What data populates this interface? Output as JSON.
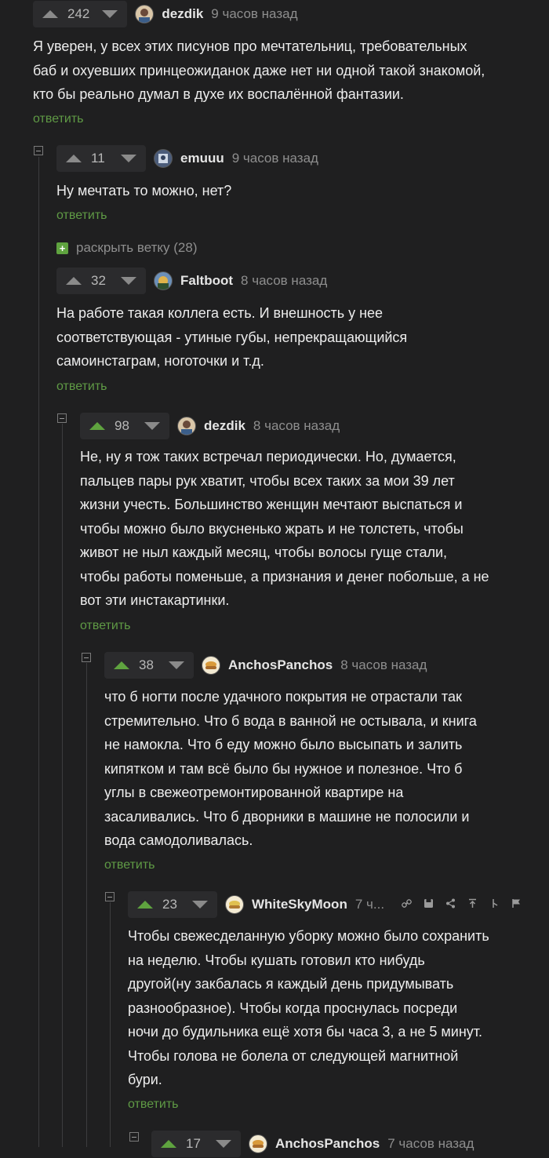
{
  "reply_label": "ответить",
  "colors": {
    "accent_green": "#5fa33f",
    "background": "#1f1f20"
  },
  "comments": [
    {
      "rating": "242",
      "user": "dezdik",
      "time": "9 часов назад",
      "lines": [
        "Я уверен, у всех этих писунов про мечтательниц, требовательных",
        "баб и охуевших принцеожиданок даже нет ни одной такой знакомой,",
        "кто бы реально думал в духе их воспалённой фантазии."
      ]
    },
    {
      "rating": "11",
      "user": "emuuu",
      "time": "9 часов назад",
      "lines": [
        "Ну мечтать то можно, нет?"
      ]
    },
    {
      "rating": "32",
      "user": "Faltboot",
      "time": "8 часов назад",
      "lines": [
        "На работе такая коллега есть. И внешность у нее",
        "соответствующая - утиные губы, непрекращающийся",
        "самоинстаграм, ноготочки и т.д."
      ]
    },
    {
      "rating": "98",
      "user": "dezdik",
      "time": "8 часов назад",
      "lines": [
        "Не, ну я тож таких встречал периодически. Но, думается,",
        "пальцев пары рук хватит, чтобы всех таких за мои 39 лет",
        "жизни учесть. Большинство женщин мечтают выспаться и",
        "чтобы можно было вкусненько жрать и не толстеть, чтобы",
        "живот не ныл каждый месяц, чтобы волосы гуще стали,",
        "чтобы работы поменьше, а признания и денег побольше, а не",
        "вот эти инстакартинки."
      ]
    },
    {
      "rating": "38",
      "user": "AnchosPanchos",
      "time": "8 часов назад",
      "lines": [
        "что б ногти после удачного покрытия не отрастали так",
        "стремительно. Что б вода в ванной не остывала, и книга",
        "не намокла. Что б еду можно было высыпать и залить",
        "кипятком и там всё было бы нужное и полезное. Что б",
        "углы в свежеотремонтированной квартире на",
        "засаливались. Что б дворники в машине не полосили и",
        "вода самодоливалась."
      ]
    },
    {
      "rating": "23",
      "user": "WhiteSkyMoon",
      "time": "7 ч...",
      "lines": [
        "Чтобы свежесделанную уборку можно было сохранить",
        "на неделю. Чтобы кушать готовил кто нибудь",
        "другой(ну закбалась я каждый день придумывать",
        "разнообразное). Чтобы когда проснулась посреди",
        "ночи до будильника ещё хотя бы часа 3, а не 5 минут.",
        "Чтобы голова не болела от следующей магнитной",
        "бури."
      ]
    },
    {
      "rating": "17",
      "user": "AnchosPanchos",
      "time": "7 часов назад",
      "lines": []
    }
  ],
  "expand_thread": {
    "label": "раскрыть ветку (28)"
  },
  "toolbar_icons": [
    "link-icon",
    "save-icon",
    "share-icon",
    "to-top-icon",
    "branch-icon",
    "flag-icon"
  ]
}
